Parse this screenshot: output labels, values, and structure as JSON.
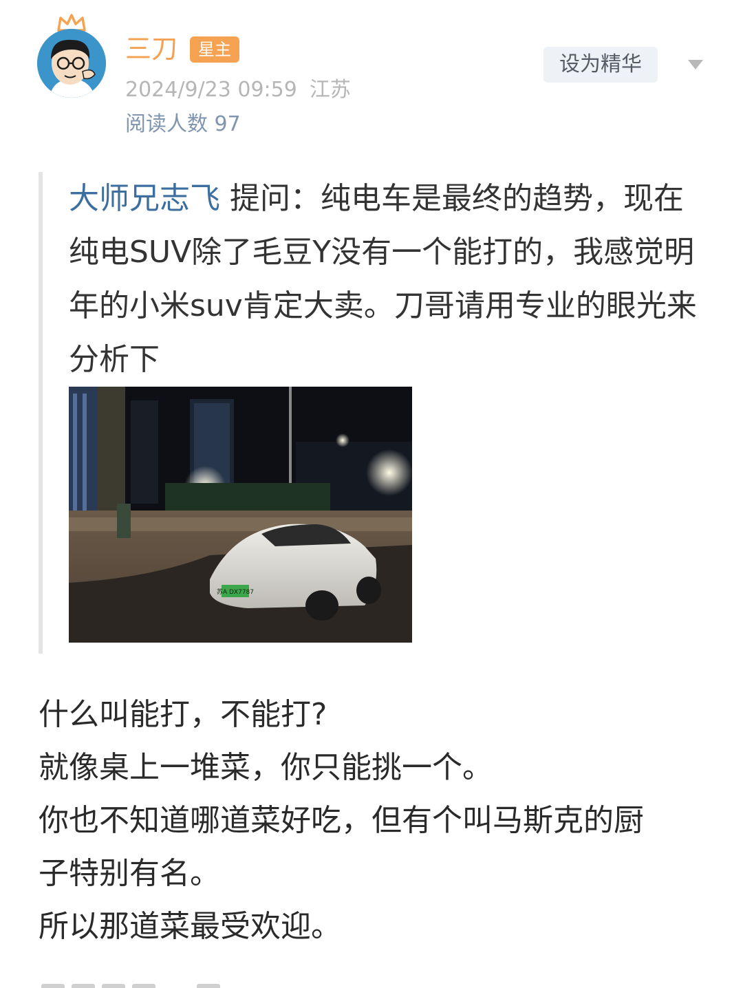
{
  "post": {
    "author": "三刀",
    "badge": "星主",
    "datetime": "2024/9/23 09:59",
    "location": "江苏",
    "reads": "阅读人数 97",
    "digest_button": "设为精华"
  },
  "question": {
    "asker": "大师兄志飞",
    "text": " 提问：纯电车是最终的趋势，现在纯电SUV除了毛豆Y没有一个能打的，我感觉明年的小米suv肯定大卖。刀哥请用专业的眼光来分析下",
    "photo": {
      "description_icon": "photo-icon",
      "plate_text": "苏A DX7787"
    }
  },
  "answer": {
    "lines": [
      "什么叫能打，不能打?",
      "就像桌上一堆菜，你只能挑一个。",
      "你也不知道哪道菜好吃，但有个叫马斯克的厨",
      "子特别有名。",
      "所以那道菜最受欢迎。"
    ]
  },
  "colors": {
    "author": "#f3a253",
    "badge_bg": "#f5a352",
    "asker": "#3c6fa0",
    "reads": "#8095b0"
  }
}
